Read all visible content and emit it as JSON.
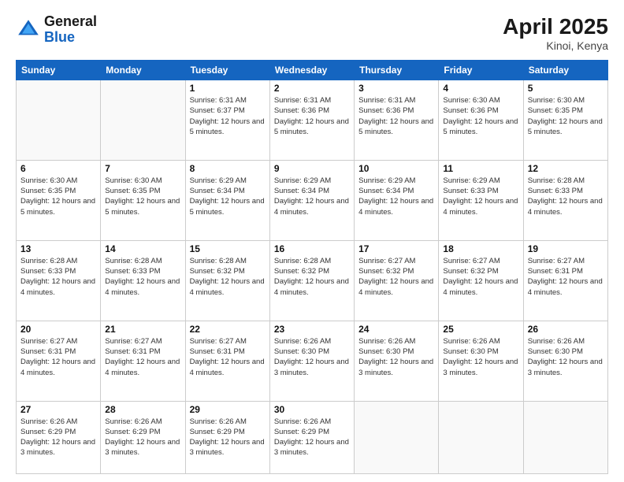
{
  "header": {
    "logo_general": "General",
    "logo_blue": "Blue",
    "month_year": "April 2025",
    "location": "Kinoi, Kenya"
  },
  "days_of_week": [
    "Sunday",
    "Monday",
    "Tuesday",
    "Wednesday",
    "Thursday",
    "Friday",
    "Saturday"
  ],
  "weeks": [
    [
      {
        "day": "",
        "info": ""
      },
      {
        "day": "",
        "info": ""
      },
      {
        "day": "1",
        "info": "Sunrise: 6:31 AM\nSunset: 6:37 PM\nDaylight: 12 hours and 5 minutes."
      },
      {
        "day": "2",
        "info": "Sunrise: 6:31 AM\nSunset: 6:36 PM\nDaylight: 12 hours and 5 minutes."
      },
      {
        "day": "3",
        "info": "Sunrise: 6:31 AM\nSunset: 6:36 PM\nDaylight: 12 hours and 5 minutes."
      },
      {
        "day": "4",
        "info": "Sunrise: 6:30 AM\nSunset: 6:36 PM\nDaylight: 12 hours and 5 minutes."
      },
      {
        "day": "5",
        "info": "Sunrise: 6:30 AM\nSunset: 6:35 PM\nDaylight: 12 hours and 5 minutes."
      }
    ],
    [
      {
        "day": "6",
        "info": "Sunrise: 6:30 AM\nSunset: 6:35 PM\nDaylight: 12 hours and 5 minutes."
      },
      {
        "day": "7",
        "info": "Sunrise: 6:30 AM\nSunset: 6:35 PM\nDaylight: 12 hours and 5 minutes."
      },
      {
        "day": "8",
        "info": "Sunrise: 6:29 AM\nSunset: 6:34 PM\nDaylight: 12 hours and 5 minutes."
      },
      {
        "day": "9",
        "info": "Sunrise: 6:29 AM\nSunset: 6:34 PM\nDaylight: 12 hours and 4 minutes."
      },
      {
        "day": "10",
        "info": "Sunrise: 6:29 AM\nSunset: 6:34 PM\nDaylight: 12 hours and 4 minutes."
      },
      {
        "day": "11",
        "info": "Sunrise: 6:29 AM\nSunset: 6:33 PM\nDaylight: 12 hours and 4 minutes."
      },
      {
        "day": "12",
        "info": "Sunrise: 6:28 AM\nSunset: 6:33 PM\nDaylight: 12 hours and 4 minutes."
      }
    ],
    [
      {
        "day": "13",
        "info": "Sunrise: 6:28 AM\nSunset: 6:33 PM\nDaylight: 12 hours and 4 minutes."
      },
      {
        "day": "14",
        "info": "Sunrise: 6:28 AM\nSunset: 6:33 PM\nDaylight: 12 hours and 4 minutes."
      },
      {
        "day": "15",
        "info": "Sunrise: 6:28 AM\nSunset: 6:32 PM\nDaylight: 12 hours and 4 minutes."
      },
      {
        "day": "16",
        "info": "Sunrise: 6:28 AM\nSunset: 6:32 PM\nDaylight: 12 hours and 4 minutes."
      },
      {
        "day": "17",
        "info": "Sunrise: 6:27 AM\nSunset: 6:32 PM\nDaylight: 12 hours and 4 minutes."
      },
      {
        "day": "18",
        "info": "Sunrise: 6:27 AM\nSunset: 6:32 PM\nDaylight: 12 hours and 4 minutes."
      },
      {
        "day": "19",
        "info": "Sunrise: 6:27 AM\nSunset: 6:31 PM\nDaylight: 12 hours and 4 minutes."
      }
    ],
    [
      {
        "day": "20",
        "info": "Sunrise: 6:27 AM\nSunset: 6:31 PM\nDaylight: 12 hours and 4 minutes."
      },
      {
        "day": "21",
        "info": "Sunrise: 6:27 AM\nSunset: 6:31 PM\nDaylight: 12 hours and 4 minutes."
      },
      {
        "day": "22",
        "info": "Sunrise: 6:27 AM\nSunset: 6:31 PM\nDaylight: 12 hours and 4 minutes."
      },
      {
        "day": "23",
        "info": "Sunrise: 6:26 AM\nSunset: 6:30 PM\nDaylight: 12 hours and 3 minutes."
      },
      {
        "day": "24",
        "info": "Sunrise: 6:26 AM\nSunset: 6:30 PM\nDaylight: 12 hours and 3 minutes."
      },
      {
        "day": "25",
        "info": "Sunrise: 6:26 AM\nSunset: 6:30 PM\nDaylight: 12 hours and 3 minutes."
      },
      {
        "day": "26",
        "info": "Sunrise: 6:26 AM\nSunset: 6:30 PM\nDaylight: 12 hours and 3 minutes."
      }
    ],
    [
      {
        "day": "27",
        "info": "Sunrise: 6:26 AM\nSunset: 6:29 PM\nDaylight: 12 hours and 3 minutes."
      },
      {
        "day": "28",
        "info": "Sunrise: 6:26 AM\nSunset: 6:29 PM\nDaylight: 12 hours and 3 minutes."
      },
      {
        "day": "29",
        "info": "Sunrise: 6:26 AM\nSunset: 6:29 PM\nDaylight: 12 hours and 3 minutes."
      },
      {
        "day": "30",
        "info": "Sunrise: 6:26 AM\nSunset: 6:29 PM\nDaylight: 12 hours and 3 minutes."
      },
      {
        "day": "",
        "info": ""
      },
      {
        "day": "",
        "info": ""
      },
      {
        "day": "",
        "info": ""
      }
    ]
  ]
}
